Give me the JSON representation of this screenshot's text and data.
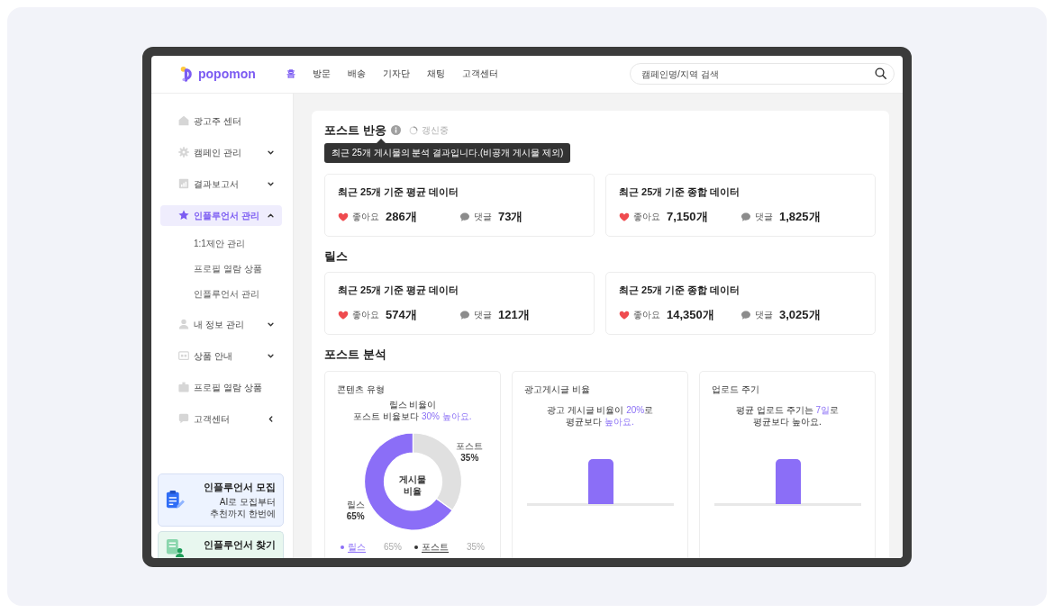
{
  "header": {
    "logo": "popomon",
    "nav": [
      {
        "label": "홈",
        "selected": true
      },
      {
        "label": "방문",
        "selected": false
      },
      {
        "label": "배송",
        "selected": false
      },
      {
        "label": "기자단",
        "selected": false
      },
      {
        "label": "채팅",
        "selected": false
      },
      {
        "label": "고객센터",
        "selected": false
      }
    ],
    "search": {
      "placeholder": "캠페인명/지역 검색"
    }
  },
  "sidebar": {
    "items": [
      {
        "kind": "link",
        "label": "광고주 센터",
        "selected": false
      },
      {
        "kind": "group",
        "label": "캠페인 관리",
        "selected": false,
        "expanded": false
      },
      {
        "kind": "group",
        "label": "결과보고서",
        "selected": false,
        "expanded": false
      },
      {
        "kind": "group",
        "label": "인플루언서 관리",
        "selected": true,
        "expanded": true,
        "children": [
          {
            "label": "1:1제안 관리",
            "selected": false
          },
          {
            "label": "프로필 열람 상품",
            "selected": false
          },
          {
            "label": "인플루언서 관리",
            "selected": false
          }
        ]
      },
      {
        "kind": "group",
        "label": "내 정보 관리",
        "selected": false,
        "expanded": false
      },
      {
        "kind": "group",
        "label": "상품 안내",
        "selected": false,
        "expanded": false
      },
      {
        "kind": "link",
        "label": "프로필 열람 상품",
        "selected": false
      },
      {
        "kind": "flyout",
        "label": "고객센터",
        "selected": false
      }
    ],
    "promos": [
      {
        "title": "인플루언서 모집",
        "subtitle": "AI로 모집부터 추천까지 한번에",
        "color": "#edf3ff"
      },
      {
        "title": "인플루언서 찾기",
        "color": "#e8f7ef"
      }
    ]
  },
  "content": {
    "sections": [
      {
        "title": "포스트 반응",
        "status": "갱신중",
        "tooltip": "최근 25개 게시물의 분석 결과입니다.(비공개 게시물 제외)",
        "cards": [
          {
            "title": "최근 25개 기준 평균 데이터",
            "stats": [
              {
                "kind": "like",
                "label": "좋아요",
                "value": "286개"
              },
              {
                "kind": "comment",
                "label": "댓글",
                "value": "73개"
              }
            ]
          },
          {
            "title": "최근 25개 기준 종합 데이터",
            "stats": [
              {
                "kind": "like",
                "label": "좋아요",
                "value": "7,150개"
              },
              {
                "kind": "comment",
                "label": "댓글",
                "value": "1,825개"
              }
            ]
          }
        ]
      },
      {
        "title": "릴스",
        "cards": [
          {
            "title": "최근 25개 기준 평균 데이터",
            "stats": [
              {
                "kind": "like",
                "label": "좋아요",
                "value": "574개"
              },
              {
                "kind": "comment",
                "label": "댓글",
                "value": "121개"
              }
            ]
          },
          {
            "title": "최근 25개 기준 종합 데이터",
            "stats": [
              {
                "kind": "like",
                "label": "좋아요",
                "value": "14,350개"
              },
              {
                "kind": "comment",
                "label": "댓글",
                "value": "3,025개"
              }
            ]
          }
        ]
      }
    ],
    "analysis": {
      "title": "포스트 분석",
      "cards": [
        {
          "kind": "donut",
          "title": "콘텐츠 유형",
          "summary": [
            {
              "text": "릴스 비율이\n포스트 비율보다 ",
              "highlight": false
            },
            {
              "text": "30% 높아요.",
              "highlight": true
            }
          ],
          "chart_data": {
            "type": "donut",
            "categories": [
              "릴스",
              "포스트"
            ],
            "values": [
              65,
              35
            ],
            "value_labels": [
              "65%",
              "35%"
            ],
            "colors": [
              "#8b6ef7",
              "#e0e0e0"
            ]
          },
          "center_label": "게시물 비율",
          "legend": [
            {
              "label": "릴스",
              "value": "65%",
              "color": "#8b6ef7"
            },
            {
              "label": "포스트",
              "value": "35%",
              "color": "#333333"
            }
          ]
        },
        {
          "kind": "bar",
          "title": "광고게시글 비율",
          "summary": [
            {
              "text": "광고 게시글 비율이 ",
              "highlight": false
            },
            {
              "text": "20%",
              "highlight": true
            },
            {
              "text": "로\n평균보다 ",
              "highlight": false
            },
            {
              "text": "높아요.",
              "highlight": true
            }
          ]
        },
        {
          "kind": "bar",
          "title": "업로드 주기",
          "summary": [
            {
              "text": "평균 업로드 주기는 ",
              "highlight": false
            },
            {
              "text": "7일",
              "highlight": true
            },
            {
              "text": "로\n평균보다 높아요.",
              "highlight": false
            }
          ]
        }
      ]
    }
  }
}
